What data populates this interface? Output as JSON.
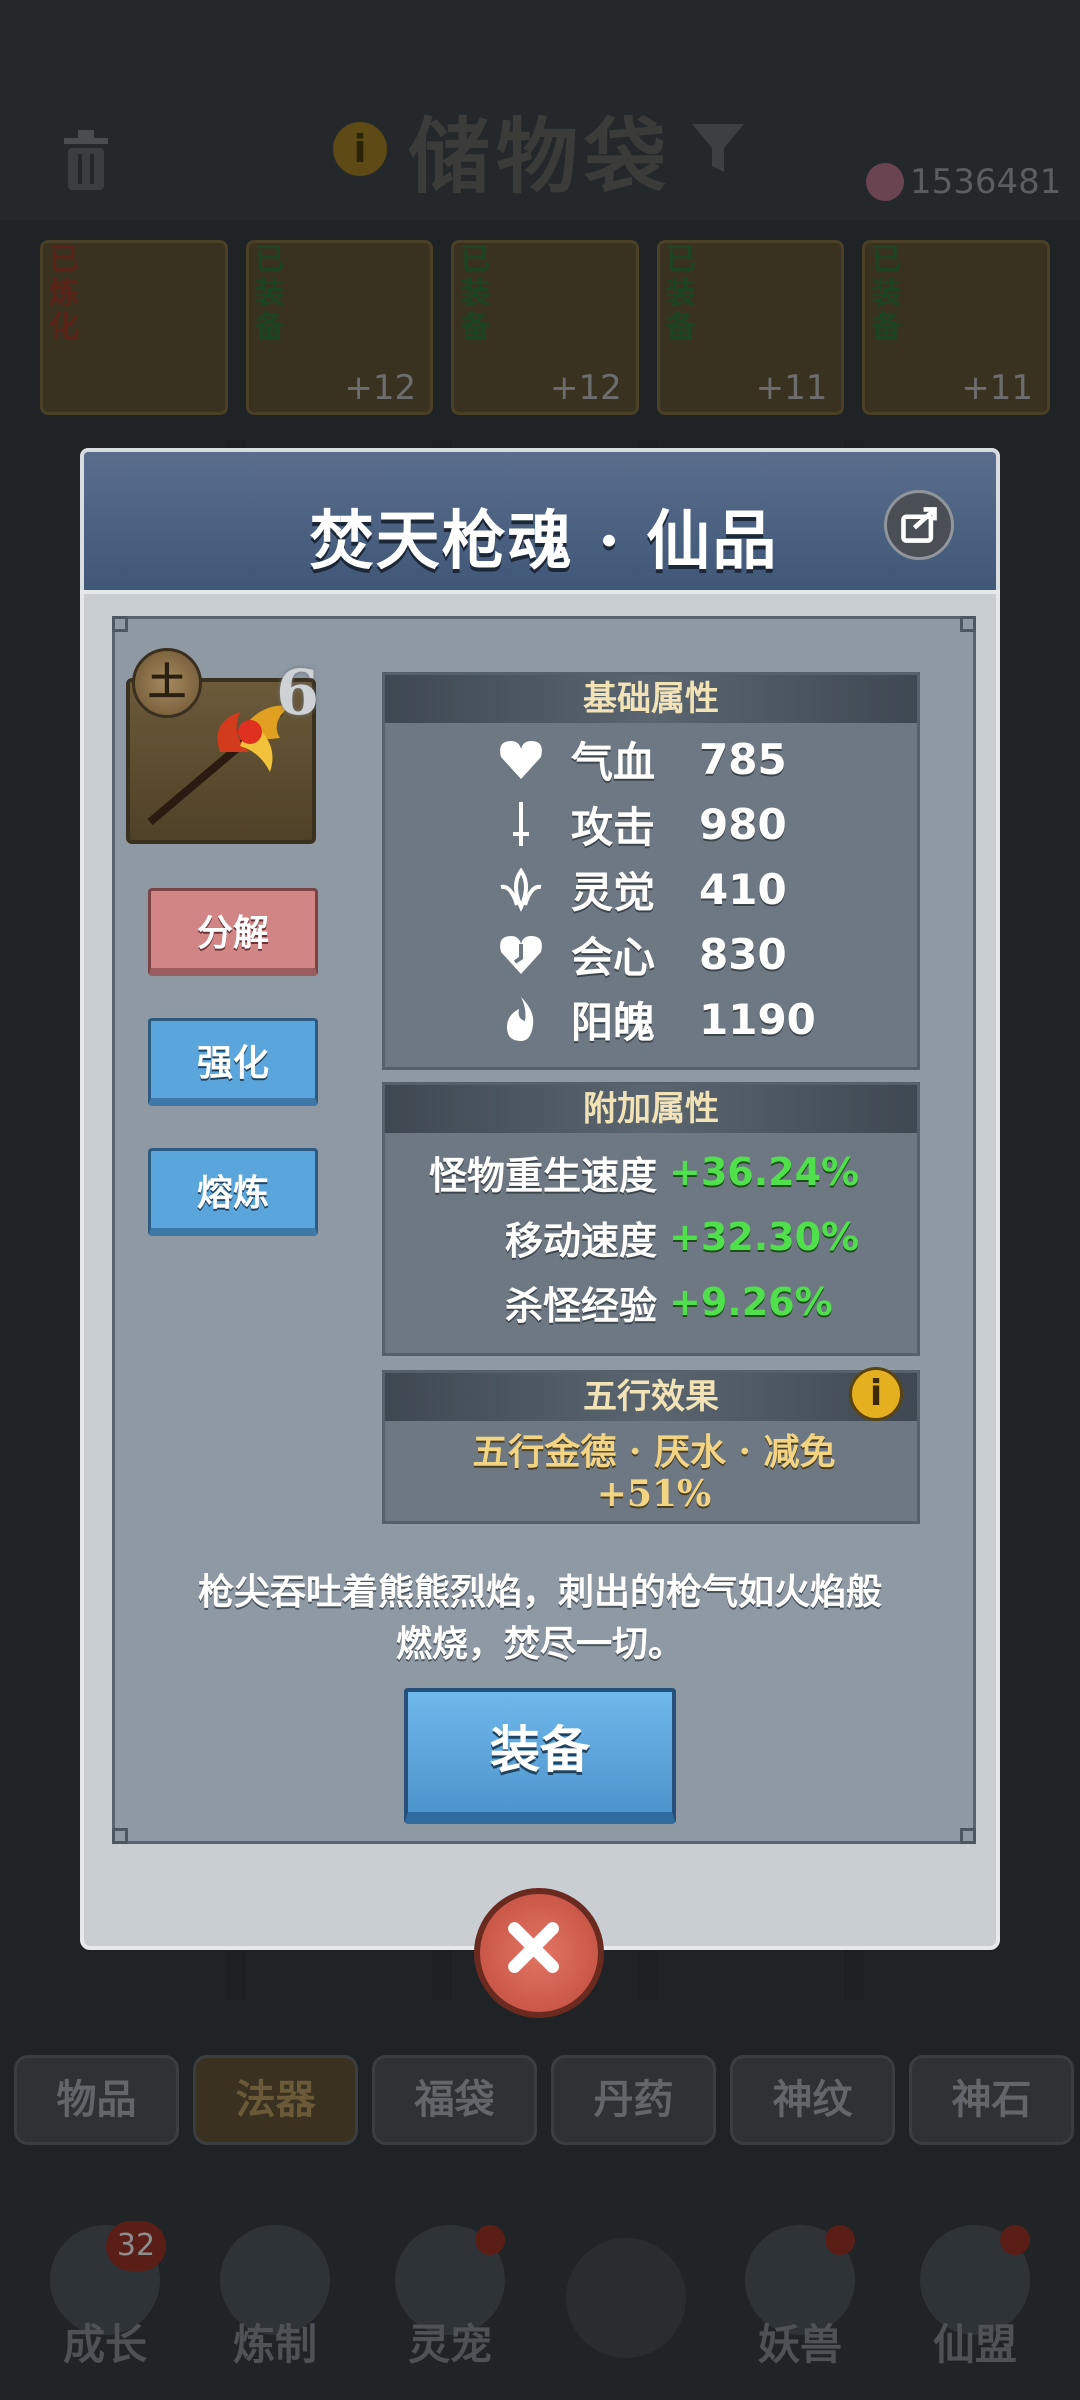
{
  "header": {
    "title": "储物袋",
    "currency_value": "1536481"
  },
  "bg_items": [
    {
      "tag": "已炼化",
      "level": ""
    },
    {
      "tag": "已装备",
      "level": "+12"
    },
    {
      "tag": "已装备",
      "level": "+12"
    },
    {
      "tag": "已装备",
      "level": "+11"
    },
    {
      "tag": "已装备",
      "level": "+11"
    }
  ],
  "tabs": [
    "物品",
    "法器",
    "福袋",
    "丹药",
    "神纹",
    "神石"
  ],
  "nav": [
    {
      "label": "成长",
      "badge": "32"
    },
    {
      "label": "炼制",
      "badge": ""
    },
    {
      "label": "灵宠",
      "badge": ""
    },
    {
      "label": "妖兽",
      "badge": ""
    },
    {
      "label": "仙盟",
      "badge": ""
    }
  ],
  "modal": {
    "title": "焚天枪魂 · 仙品",
    "element_badge": "土",
    "grade_badge": "6",
    "buttons": {
      "decompose": "分解",
      "enhance": "强化",
      "smelt": "熔炼",
      "equip": "装备"
    },
    "base_title": "基础属性",
    "base_stats": [
      {
        "icon": "heart-icon",
        "name": "气血",
        "value": "785"
      },
      {
        "icon": "sword-icon",
        "name": "攻击",
        "value": "980"
      },
      {
        "icon": "spirit-icon",
        "name": "灵觉",
        "value": "410"
      },
      {
        "icon": "crit-heart-icon",
        "name": "会心",
        "value": "830"
      },
      {
        "icon": "flame-icon",
        "name": "阳魄",
        "value": "1190"
      }
    ],
    "extra_title": "附加属性",
    "extra_stats": [
      {
        "name": "怪物重生速度",
        "value": "+36.24%"
      },
      {
        "name": "移动速度",
        "value": "+32.30%"
      },
      {
        "name": "杀怪经验",
        "value": "+9.26%"
      }
    ],
    "wuxing_title": "五行效果",
    "wuxing_line1": "五行金德 · 厌水 · 减免",
    "wuxing_line2": "+51%",
    "desc_line1": "枪尖吞吐着熊熊烈焰，刺出的枪气如火焰般",
    "desc_line2": "燃烧，焚尽一切。"
  },
  "colors": {
    "accent_green": "#4fe04c",
    "title_gold": "#f2e3b6",
    "button_blue": "#5aa5db",
    "button_red": "#d28585"
  }
}
